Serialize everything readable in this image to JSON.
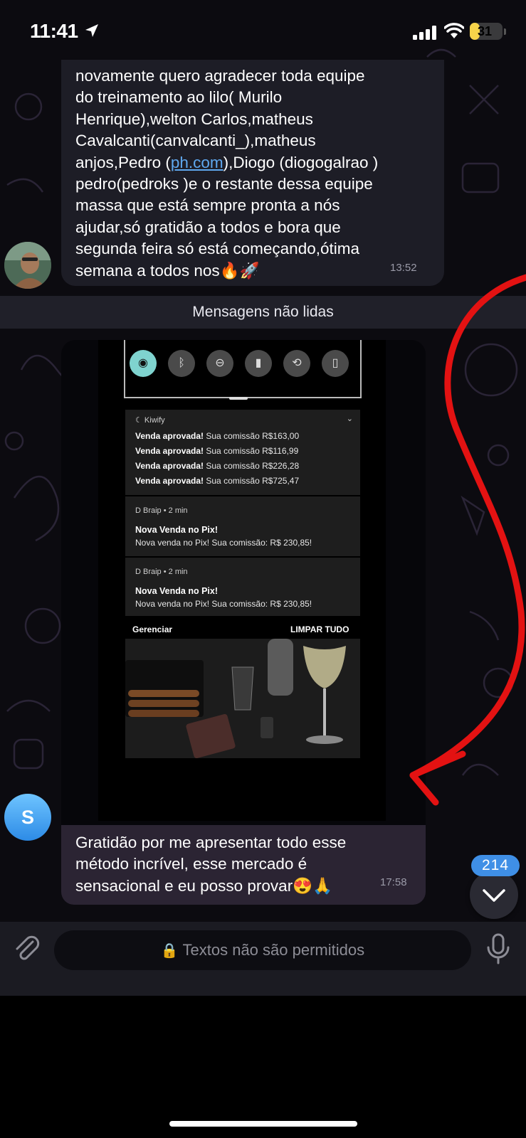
{
  "status_bar": {
    "time": "11:41",
    "battery": "31",
    "battery_level": 0.31
  },
  "messages": [
    {
      "id": "msg1",
      "text_before_link": "novamente quero agradecer toda equipe\ndo treinamento ao lilo( Murilo\nHenrique),welton Carlos,matheus\nCavalcanti(canvalcanti_),matheus\nanjos,Pedro (",
      "link": "ph.com",
      "text_after_link": "),Diogo (diogogalrao )\npedro(pedroks )e o restante dessa equipe\nmassa que está sempre pronta a nós\najudar,só gratidão a todos e bora que\nsegunda feira só está começando,ótima\nsemana a todos nos🔥🚀",
      "time": "13:52"
    },
    {
      "id": "msg2",
      "caption": "Gratidão por me apresentar todo esse\nmétodo incrível, esse mercado é\nsensacional e eu posso provar😍🙏",
      "time": "17:58",
      "avatar_letter": "S"
    }
  ],
  "unread_separator": "Mensagens não lidas",
  "screenshot": {
    "kiwify": {
      "app": "Kiwify",
      "lines": [
        {
          "bold": "Venda aprovada!",
          "rest": " Sua comissão R$163,00"
        },
        {
          "bold": "Venda aprovada!",
          "rest": " Sua comissão R$116,99"
        },
        {
          "bold": "Venda aprovada!",
          "rest": " Sua comissão R$226,28"
        },
        {
          "bold": "Venda aprovada!",
          "rest": " Sua comissão R$725,47"
        }
      ]
    },
    "braip": [
      {
        "app": "Braip • 2 min",
        "title": "Nova Venda no Pix!",
        "body": "Nova venda no Pix! Sua comissão: R$ 230,85!"
      },
      {
        "app": "Braip • 2 min",
        "title": "Nova Venda no Pix!",
        "body": "Nova venda no Pix! Sua comissão: R$ 230,85!"
      }
    ],
    "manage": "Gerenciar",
    "clear_all": "LIMPAR TUDO"
  },
  "scroll": {
    "unread_count": "214"
  },
  "input": {
    "placeholder": "Textos não são permitidos"
  },
  "colors": {
    "accent": "#3f8fe6",
    "annotation": "#e31212"
  }
}
